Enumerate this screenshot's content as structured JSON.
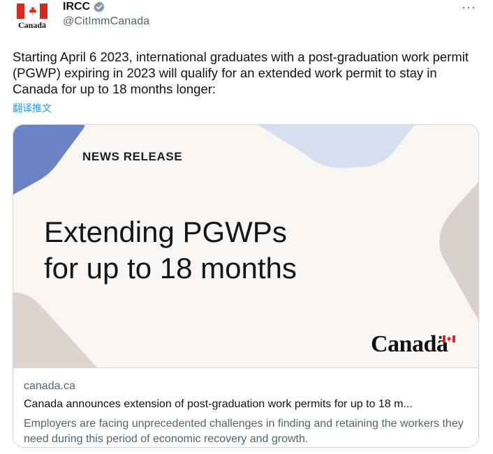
{
  "author": {
    "display_name": "IRCC",
    "handle": "@CitImmCanada",
    "avatar_wordmark": "Canadä",
    "verified_icon": "verified-badge-icon"
  },
  "tweet": {
    "text": "Starting April 6 2023, international graduates with a post-graduation work permit (PGWP) expiring in 2023 will qualify for an extended work permit to stay in Canada for up to 18 months longer:",
    "translate_label": "翻译推文",
    "more_label": "···"
  },
  "card": {
    "image": {
      "label": "NEWS RELEASE",
      "headline_line1": "Extending PGWPs",
      "headline_line2": "for up to 18 months",
      "wordmark": "Canadä"
    },
    "domain": "canada.ca",
    "title": "Canada announces extension of post-graduation work permits for up to 18 m...",
    "description": "Employers are facing unprecedented challenges in finding and retaining the workers they need during this period of economic recovery and growth."
  },
  "colors": {
    "link": "#1d9bf0",
    "secondary_text": "#536471",
    "flag_red": "#d52b1e",
    "image_bg": "#faf6f4"
  }
}
